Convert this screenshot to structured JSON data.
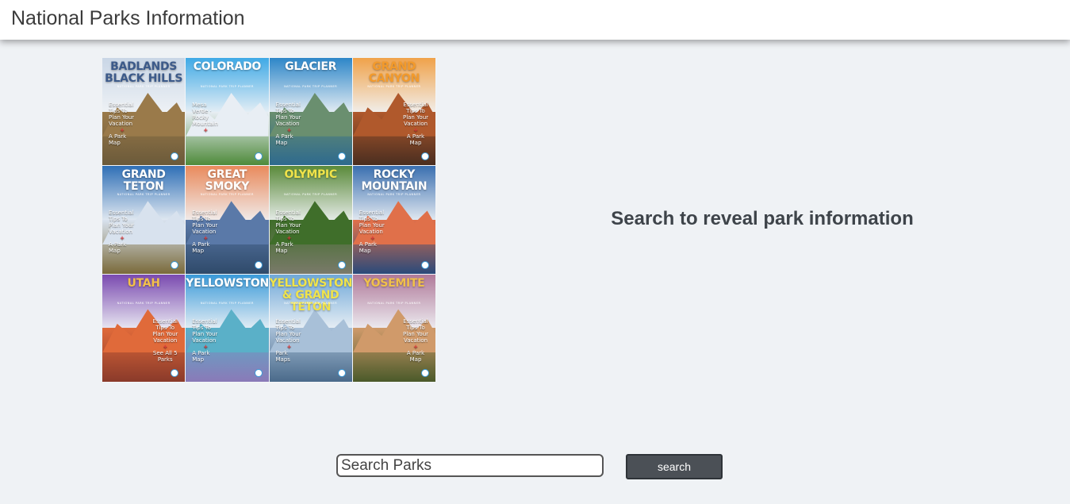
{
  "header": {
    "title": "National Parks Information"
  },
  "guides": [
    {
      "title": "BADLANDS BLACK HILLS",
      "subtitle": "NATIONAL PARK TRIP PLANNER",
      "tips": "Essential Tips To Plan Your Vacation",
      "extra": "A Park Map",
      "sky": "#c9d6e6",
      "mtn": "#9a7a4a",
      "land": "#6b5a3a",
      "title_color": "#3c5a8a"
    },
    {
      "title": "COLORADO",
      "subtitle": "NATIONAL PARK TRIP PLANNER",
      "tips": "Mesa Verde · Rocky Mountain",
      "extra": "",
      "sky": "#3fa9e6",
      "mtn": "#e8eef4",
      "land": "#4e8a3a",
      "title_color": "#ffffff"
    },
    {
      "title": "GLACIER",
      "subtitle": "NATIONAL PARK TRIP PLANNER",
      "tips": "Essential Tips To Plan Your Vacation",
      "extra": "A Park Map",
      "sky": "#2d86c8",
      "mtn": "#6a8f6f",
      "land": "#2e6a8e",
      "title_color": "#ffffff"
    },
    {
      "title": "GRAND CANYON",
      "subtitle": "NATIONAL PARK TRIP PLANNER",
      "tips": "Essential Tips To Plan Your Vacation",
      "extra": "A Park Map",
      "sky": "#f0a24a",
      "mtn": "#b0592c",
      "land": "#4a2e20",
      "title_color": "#f39a2b"
    },
    {
      "title": "GRAND TETON",
      "subtitle": "NATIONAL PARK TRIP PLANNER",
      "tips": "Essential Tips To Plan Your Vacation",
      "extra": "A Park Map",
      "sky": "#2f6fb6",
      "mtn": "#d8e2ee",
      "land": "#7a6a3a",
      "title_color": "#ffffff"
    },
    {
      "title": "GREAT SMOKY",
      "subtitle": "NATIONAL PARK TRIP PLANNER",
      "tips": "Essential Tips To Plan Your Vacation",
      "extra": "A Park Map",
      "sky": "#e98a5c",
      "mtn": "#5a79a8",
      "land": "#2f4a6a",
      "title_color": "#ffffff"
    },
    {
      "title": "OLYMPIC",
      "subtitle": "NATIONAL PARK TRIP PLANNER",
      "tips": "Essential Tips To Plan Your Vacation",
      "extra": "A Park Map",
      "sky": "#5a8a3a",
      "mtn": "#3f6e2a",
      "land": "#7a7a6a",
      "title_color": "#f0e34a"
    },
    {
      "title": "ROCKY MOUNTAIN",
      "subtitle": "NATIONAL PARK TRIP PLANNER",
      "tips": "Essential Tips To Plan Your Vacation",
      "extra": "A Park Map",
      "sky": "#3a6fb0",
      "mtn": "#e0704a",
      "land": "#2a4a7a",
      "title_color": "#ffffff"
    },
    {
      "title": "UTAH",
      "subtitle": "NATIONAL PARK TRIP PLANNER",
      "tips": "Essential Tips To Plan Your Vacation",
      "extra": "See All 5 Parks",
      "sky": "#7a4ab0",
      "mtn": "#e06a3a",
      "land": "#8a3a2a",
      "title_color": "#f3c04a"
    },
    {
      "title": "YELLOWSTONE",
      "subtitle": "NATIONAL PARK TRIP PLANNER",
      "tips": "Essential Tips To Plan Your Vacation",
      "extra": "A Park Map",
      "sky": "#3a9ad9",
      "mtn": "#5ab0c8",
      "land": "#8a7ab8",
      "title_color": "#ffffff"
    },
    {
      "title": "YELLOWSTONE & GRAND TETON",
      "subtitle": "NATIONAL PARK TRIP PLANNER",
      "tips": "Essential Tips To Plan Your Vacation",
      "extra": "Park Maps",
      "sky": "#6fa8d8",
      "mtn": "#a8c0d8",
      "land": "#4a6a8a",
      "title_color": "#f0e34a"
    },
    {
      "title": "YOSEMITE",
      "subtitle": "NATIONAL PARK TRIP PLANNER",
      "tips": "Essential Tips To Plan Your Vacation",
      "extra": "A Park Map",
      "sky": "#b07a9a",
      "mtn": "#d09a6a",
      "land": "#4a5a2a",
      "title_color": "#f0c04a"
    }
  ],
  "main": {
    "prompt": "Search to reveal park information"
  },
  "search": {
    "placeholder": "Search Parks",
    "value": "",
    "button_label": "search"
  }
}
